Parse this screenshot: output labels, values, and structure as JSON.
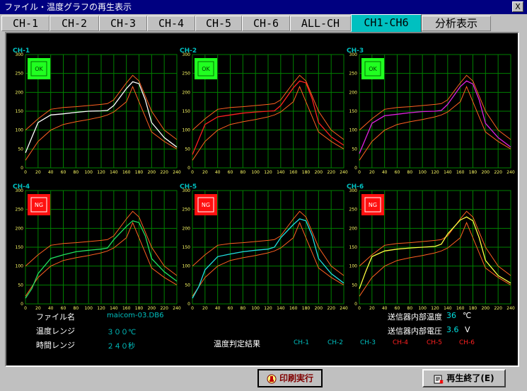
{
  "window": {
    "title": "ファイル・温度グラフの再生表示",
    "close_label": "X"
  },
  "tabs": [
    {
      "label": "CH-1"
    },
    {
      "label": "CH-2"
    },
    {
      "label": "CH-3"
    },
    {
      "label": "CH-4"
    },
    {
      "label": "CH-5"
    },
    {
      "label": "CH-6"
    },
    {
      "label": "ALL-CH"
    },
    {
      "label": "CH1-CH6",
      "active": true
    },
    {
      "label": "分析表示"
    }
  ],
  "chart_data": [
    {
      "type": "line",
      "title": "CH-1",
      "badge": "OK",
      "color": "#ffffff",
      "x": [
        0,
        10,
        20,
        40,
        60,
        80,
        100,
        120,
        130,
        140,
        160,
        170,
        180,
        190,
        200,
        220,
        240
      ],
      "series": [
        {
          "values": [
            40,
            80,
            120,
            140,
            143,
            147,
            150,
            151,
            152,
            165,
            210,
            228,
            223,
            180,
            120,
            80,
            55
          ]
        }
      ],
      "upper": {
        "x": [
          0,
          20,
          40,
          60,
          80,
          100,
          120,
          130,
          140,
          160,
          170,
          180,
          200,
          220,
          240
        ],
        "values": [
          100,
          130,
          155,
          160,
          162,
          165,
          168,
          170,
          180,
          225,
          245,
          230,
          150,
          100,
          75
        ]
      },
      "lower": {
        "x": [
          0,
          20,
          40,
          60,
          80,
          100,
          120,
          130,
          140,
          160,
          170,
          180,
          200,
          220,
          240
        ],
        "values": [
          20,
          70,
          100,
          115,
          122,
          128,
          135,
          140,
          148,
          175,
          215,
          175,
          95,
          70,
          50
        ]
      },
      "xlim": [
        0,
        240
      ],
      "ylim": [
        0,
        300
      ],
      "xticks": [
        0,
        20,
        40,
        60,
        80,
        100,
        120,
        140,
        160,
        180,
        200,
        220,
        240
      ],
      "yticks": [
        0,
        50,
        100,
        150,
        200,
        250,
        300
      ]
    },
    {
      "type": "line",
      "title": "CH-2",
      "badge": "OK",
      "color": "#ff2020",
      "x": [
        0,
        10,
        20,
        40,
        60,
        80,
        100,
        120,
        130,
        140,
        160,
        170,
        180,
        190,
        200,
        220,
        240
      ],
      "series": [
        {
          "values": [
            35,
            75,
            115,
            135,
            140,
            145,
            148,
            150,
            151,
            165,
            212,
            230,
            225,
            182,
            120,
            82,
            60
          ]
        }
      ],
      "upper": {
        "x": [
          0,
          20,
          40,
          60,
          80,
          100,
          120,
          130,
          140,
          160,
          170,
          180,
          200,
          220,
          240
        ],
        "values": [
          100,
          130,
          155,
          160,
          162,
          165,
          168,
          170,
          180,
          225,
          245,
          230,
          150,
          100,
          75
        ]
      },
      "lower": {
        "x": [
          0,
          20,
          40,
          60,
          80,
          100,
          120,
          130,
          140,
          160,
          170,
          180,
          200,
          220,
          240
        ],
        "values": [
          20,
          70,
          100,
          115,
          122,
          128,
          135,
          140,
          148,
          175,
          215,
          175,
          95,
          70,
          50
        ]
      },
      "xlim": [
        0,
        240
      ],
      "ylim": [
        0,
        300
      ],
      "xticks": [
        0,
        20,
        40,
        60,
        80,
        100,
        120,
        140,
        160,
        180,
        200,
        220,
        240
      ],
      "yticks": [
        0,
        50,
        100,
        150,
        200,
        250,
        300
      ]
    },
    {
      "type": "line",
      "title": "CH-3",
      "badge": "OK",
      "color": "#e020e0",
      "x": [
        0,
        10,
        20,
        40,
        60,
        80,
        100,
        120,
        130,
        140,
        160,
        170,
        180,
        190,
        200,
        220,
        240
      ],
      "series": [
        {
          "values": [
            38,
            78,
            118,
            138,
            142,
            146,
            149,
            150,
            152,
            168,
            215,
            230,
            222,
            180,
            118,
            80,
            55
          ]
        }
      ],
      "upper": {
        "x": [
          0,
          20,
          40,
          60,
          80,
          100,
          120,
          130,
          140,
          160,
          170,
          180,
          200,
          220,
          240
        ],
        "values": [
          100,
          130,
          155,
          160,
          162,
          165,
          168,
          170,
          180,
          225,
          245,
          230,
          150,
          100,
          75
        ]
      },
      "lower": {
        "x": [
          0,
          20,
          40,
          60,
          80,
          100,
          120,
          130,
          140,
          160,
          170,
          180,
          200,
          220,
          240
        ],
        "values": [
          20,
          70,
          100,
          115,
          122,
          128,
          135,
          140,
          148,
          175,
          215,
          175,
          95,
          70,
          50
        ]
      },
      "xlim": [
        0,
        240
      ],
      "ylim": [
        0,
        300
      ],
      "xticks": [
        0,
        20,
        40,
        60,
        80,
        100,
        120,
        140,
        160,
        180,
        200,
        220,
        240
      ],
      "yticks": [
        0,
        50,
        100,
        150,
        200,
        250,
        300
      ]
    },
    {
      "type": "line",
      "title": "CH-4",
      "badge": "NG",
      "color": "#20e060",
      "x": [
        0,
        10,
        20,
        40,
        60,
        80,
        100,
        120,
        130,
        140,
        160,
        170,
        180,
        190,
        200,
        220,
        240
      ],
      "series": [
        {
          "values": [
            15,
            40,
            80,
            120,
            130,
            138,
            142,
            145,
            148,
            170,
            205,
            220,
            215,
            180,
            120,
            85,
            60
          ]
        }
      ],
      "upper": {
        "x": [
          0,
          20,
          40,
          60,
          80,
          100,
          120,
          130,
          140,
          160,
          170,
          180,
          200,
          220,
          240
        ],
        "values": [
          100,
          130,
          155,
          160,
          162,
          165,
          168,
          170,
          180,
          225,
          245,
          230,
          150,
          100,
          75
        ]
      },
      "lower": {
        "x": [
          0,
          20,
          40,
          60,
          80,
          100,
          120,
          130,
          140,
          160,
          170,
          180,
          200,
          220,
          240
        ],
        "values": [
          20,
          70,
          100,
          115,
          122,
          128,
          135,
          140,
          148,
          175,
          215,
          175,
          95,
          70,
          50
        ]
      },
      "xlim": [
        0,
        240
      ],
      "ylim": [
        0,
        300
      ],
      "xticks": [
        0,
        20,
        40,
        60,
        80,
        100,
        120,
        140,
        160,
        180,
        200,
        220,
        240
      ],
      "yticks": [
        0,
        50,
        100,
        150,
        200,
        250,
        300
      ]
    },
    {
      "type": "line",
      "title": "CH-5",
      "badge": "NG",
      "color": "#20e0e0",
      "x": [
        0,
        10,
        20,
        40,
        60,
        80,
        100,
        120,
        130,
        140,
        160,
        170,
        180,
        190,
        200,
        220,
        240
      ],
      "series": [
        {
          "values": [
            15,
            45,
            90,
            125,
            132,
            138,
            142,
            145,
            150,
            175,
            210,
            225,
            220,
            180,
            120,
            80,
            55
          ]
        }
      ],
      "upper": {
        "x": [
          0,
          20,
          40,
          60,
          80,
          100,
          120,
          130,
          140,
          160,
          170,
          180,
          200,
          220,
          240
        ],
        "values": [
          100,
          130,
          155,
          160,
          162,
          165,
          168,
          170,
          180,
          225,
          245,
          230,
          150,
          100,
          75
        ]
      },
      "lower": {
        "x": [
          0,
          20,
          40,
          60,
          80,
          100,
          120,
          130,
          140,
          160,
          170,
          180,
          200,
          220,
          240
        ],
        "values": [
          20,
          70,
          100,
          115,
          122,
          128,
          135,
          140,
          148,
          175,
          215,
          175,
          95,
          70,
          50
        ]
      },
      "xlim": [
        0,
        240
      ],
      "ylim": [
        0,
        300
      ],
      "xticks": [
        0,
        20,
        40,
        60,
        80,
        100,
        120,
        140,
        160,
        180,
        200,
        220,
        240
      ],
      "yticks": [
        0,
        50,
        100,
        150,
        200,
        250,
        300
      ]
    },
    {
      "type": "line",
      "title": "CH-6",
      "badge": "NG",
      "color": "#ffff40",
      "x": [
        0,
        10,
        20,
        40,
        60,
        80,
        100,
        120,
        130,
        140,
        160,
        170,
        180,
        190,
        200,
        220,
        240
      ],
      "series": [
        {
          "values": [
            40,
            85,
            125,
            140,
            145,
            148,
            150,
            152,
            158,
            185,
            222,
            230,
            220,
            175,
            115,
            75,
            55
          ]
        }
      ],
      "upper": {
        "x": [
          0,
          20,
          40,
          60,
          80,
          100,
          120,
          130,
          140,
          160,
          170,
          180,
          200,
          220,
          240
        ],
        "values": [
          100,
          130,
          155,
          160,
          162,
          165,
          168,
          170,
          180,
          225,
          245,
          230,
          150,
          100,
          75
        ]
      },
      "lower": {
        "x": [
          0,
          20,
          40,
          60,
          80,
          100,
          120,
          130,
          140,
          160,
          170,
          180,
          200,
          220,
          240
        ],
        "values": [
          20,
          70,
          100,
          115,
          122,
          128,
          135,
          140,
          148,
          175,
          215,
          175,
          95,
          70,
          50
        ]
      },
      "xlim": [
        0,
        240
      ],
      "ylim": [
        0,
        300
      ],
      "xticks": [
        0,
        20,
        40,
        60,
        80,
        100,
        120,
        140,
        160,
        180,
        200,
        220,
        240
      ],
      "yticks": [
        0,
        50,
        100,
        150,
        200,
        250,
        300
      ]
    }
  ],
  "info": {
    "file_label": "ファイル名",
    "file_value": "maicom-03.DB6",
    "range_label": "温度レンジ",
    "range_value": "３００℃",
    "time_label": "時間レンジ",
    "time_value": "２４０秒",
    "temp_label": "送信器内部温度",
    "temp_value": "36",
    "temp_unit": "℃",
    "volt_label": "送信器内部電圧",
    "volt_value": "3.6",
    "volt_unit": "V",
    "result_label": "温度判定結果"
  },
  "results": [
    {
      "label": "CH-1",
      "color": "#00c0c0"
    },
    {
      "label": "CH-2",
      "color": "#00c0c0"
    },
    {
      "label": "CH-3",
      "color": "#00c0c0"
    },
    {
      "label": "CH-4",
      "color": "#ff2020"
    },
    {
      "label": "CH-5",
      "color": "#ff2020"
    },
    {
      "label": "CH-6",
      "color": "#ff2020"
    }
  ],
  "buttons": {
    "print": "印刷実行",
    "end": "再生終了(E)"
  },
  "colors": {
    "grid": "#008000",
    "limit": "#ff6020",
    "ok": "#20ff20",
    "ng": "#ff1010",
    "active_tab": "#00c0c0"
  }
}
